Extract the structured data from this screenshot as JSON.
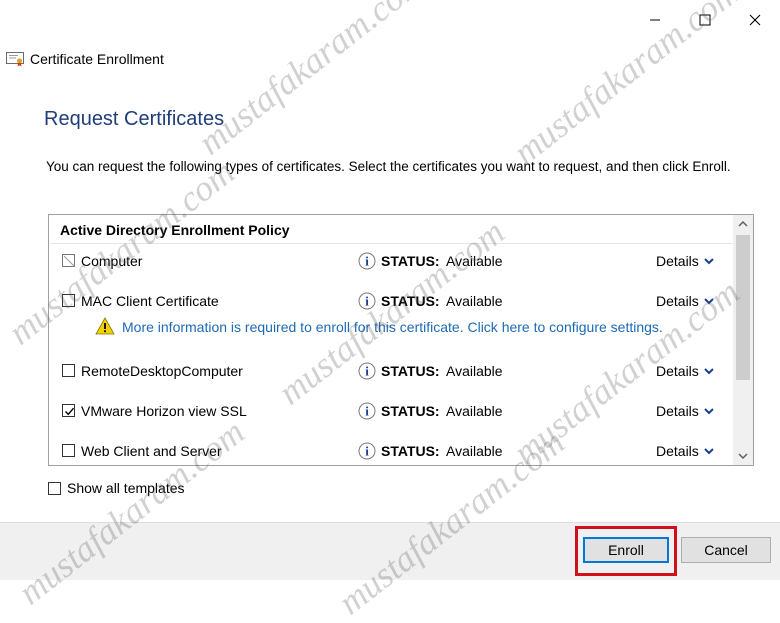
{
  "window": {
    "minimize_label": "minimize",
    "maximize_label": "maximize",
    "close_label": "close"
  },
  "app": {
    "title": "Certificate Enrollment"
  },
  "page": {
    "title": "Request Certificates",
    "intro": "You can request the following types of certificates. Select the certificates you want to request, and then click Enroll."
  },
  "policy": {
    "group_title": "Active Directory Enrollment Policy",
    "status_label": "STATUS:",
    "details_label": "Details",
    "items": [
      {
        "name": "Computer",
        "status": "Available",
        "checked": false,
        "disabled": true
      },
      {
        "name": "MAC Client Certificate",
        "status": "Available",
        "checked": false,
        "disabled": false
      },
      {
        "name": "RemoteDesktopComputer",
        "status": "Available",
        "checked": false,
        "disabled": false
      },
      {
        "name": "VMware Horizon view SSL",
        "status": "Available",
        "checked": true,
        "disabled": false
      },
      {
        "name": "Web Client and Server",
        "status": "Available",
        "checked": false,
        "disabled": false
      }
    ],
    "warning": "More information is required to enroll for this certificate. Click here to configure settings."
  },
  "options": {
    "show_all_label": "Show all templates"
  },
  "buttons": {
    "enroll": "Enroll",
    "cancel": "Cancel"
  },
  "watermark": "mustafakaram.com",
  "colors": {
    "accent": "#0078d7",
    "title": "#1f3e7a",
    "link": "#1d6ab5",
    "highlight": "#d0101a",
    "warning": "#f2d200"
  }
}
